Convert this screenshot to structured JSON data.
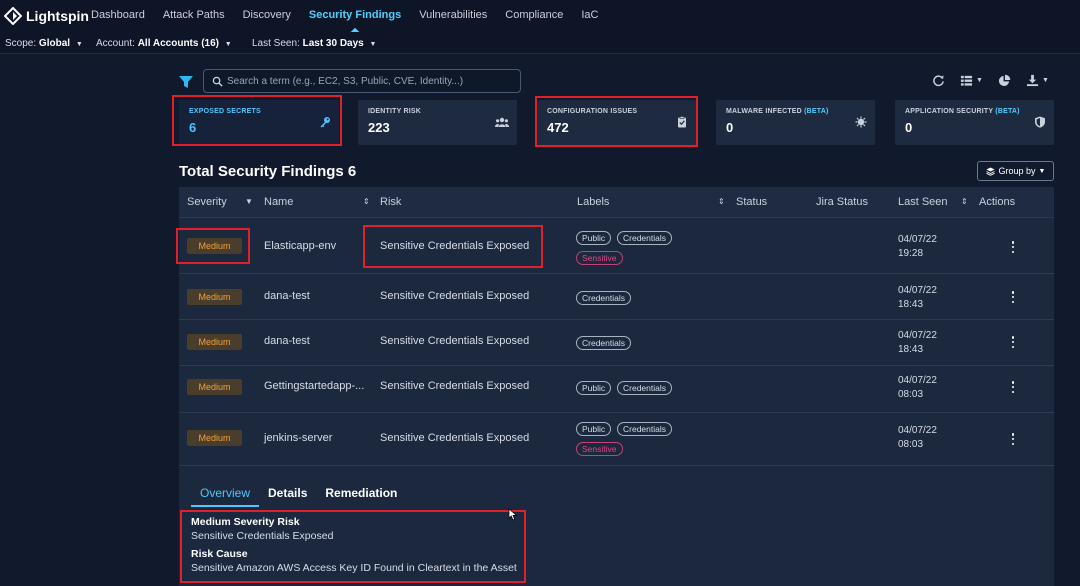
{
  "app": {
    "brand": "Lightspin"
  },
  "nav": {
    "links": [
      "Dashboard",
      "Attack Paths",
      "Discovery",
      "Security Findings",
      "Vulnerabilities",
      "Compliance",
      "IaC"
    ],
    "active": "Security Findings"
  },
  "scope": {
    "scope_label": "Scope:",
    "scope_value": "Global",
    "account_label": "Account:",
    "account_value": "All Accounts (16)",
    "last_seen_label": "Last Seen:",
    "last_seen_value": "Last 30 Days"
  },
  "search": {
    "placeholder": "Search a term (e.g., EC2, S3, Public, CVE, Identity...)"
  },
  "cards": [
    {
      "title": "EXPOSED SECRETS",
      "beta": "",
      "value": "6",
      "icon": "key-icon",
      "selected": true
    },
    {
      "title": "IDENTITY RISK",
      "beta": "",
      "value": "223",
      "icon": "users-icon"
    },
    {
      "title": "CONFIGURATION ISSUES",
      "beta": "",
      "value": "472",
      "icon": "clipboard-icon"
    },
    {
      "title": "MALWARE INFECTED",
      "beta": "(BETA)",
      "value": "0",
      "icon": "virus-icon"
    },
    {
      "title": "APPLICATION SECURITY",
      "beta": "(BETA)",
      "value": "0",
      "icon": "shield-icon"
    }
  ],
  "main": {
    "title": "Total Security Findings 6",
    "group_by_label": "Group by"
  },
  "table": {
    "columns": [
      "Severity",
      "Name",
      "Risk",
      "Labels",
      "Status",
      "Jira Status",
      "Last Seen",
      "Actions"
    ],
    "rows": [
      {
        "severity": "Medium",
        "name": "Elasticapp-env",
        "risk": "Sensitive Credentials Exposed",
        "labels": [
          "Public",
          "Credentials",
          "Sensitive"
        ],
        "date": "04/07/22",
        "time": "19:28"
      },
      {
        "severity": "Medium",
        "name": "dana-test",
        "risk": "Sensitive Credentials Exposed",
        "labels": [
          "Credentials"
        ],
        "date": "04/07/22",
        "time": "18:43"
      },
      {
        "severity": "Medium",
        "name": "dana-test",
        "risk": "Sensitive Credentials Exposed",
        "labels": [
          "Credentials"
        ],
        "date": "04/07/22",
        "time": "18:43"
      },
      {
        "severity": "Medium",
        "name": "Gettingstartedapp-...",
        "risk": "Sensitive Credentials Exposed",
        "labels": [
          "Public",
          "Credentials"
        ],
        "date": "04/07/22",
        "time": "08:03"
      },
      {
        "severity": "Medium",
        "name": "jenkins-server",
        "risk": "Sensitive Credentials Exposed",
        "labels": [
          "Public",
          "Credentials",
          "Sensitive"
        ],
        "date": "04/07/22",
        "time": "08:03"
      }
    ]
  },
  "detail": {
    "tabs": [
      "Overview",
      "Details",
      "Remediation"
    ],
    "active_tab": "Overview",
    "risk_heading": "Medium Severity Risk",
    "risk_text": "Sensitive Credentials Exposed",
    "cause_heading": "Risk Cause",
    "cause_text": "Sensitive Amazon AWS Access Key ID Found in Cleartext in the Asset"
  },
  "colors": {
    "accent": "#4fc6ff",
    "highlight_box": "#e0202a",
    "severity_medium": "#f0a13a",
    "label_sensitive": "#e0488c"
  }
}
